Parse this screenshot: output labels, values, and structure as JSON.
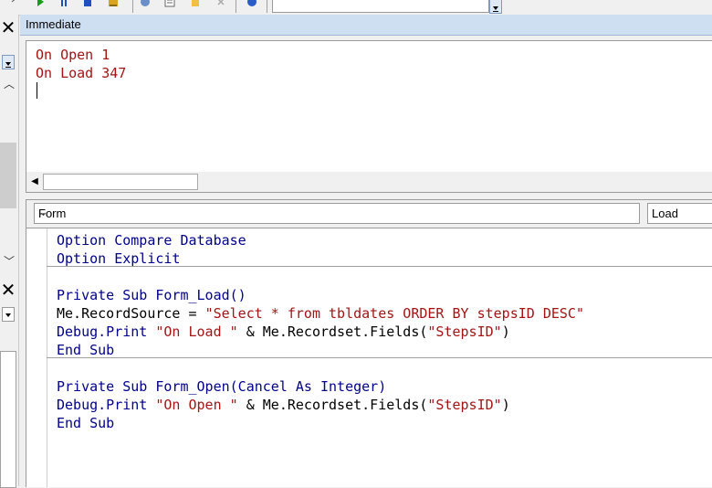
{
  "toolbar": {
    "icons": [
      "run-icon",
      "break-icon",
      "reset-icon",
      "design-mode-icon",
      "project-explorer-icon",
      "properties-icon",
      "object-browser-icon",
      "toolbox-icon",
      "help-icon"
    ]
  },
  "immediate": {
    "title": "Immediate",
    "lines": [
      "On Open 1",
      "On Load 347"
    ]
  },
  "code_window": {
    "object_selector": "Form",
    "procedure_selector": "Load",
    "declarations": [
      {
        "kw": "Option Compare Database"
      },
      {
        "kw": "Option Explicit"
      }
    ],
    "form_load": {
      "signature": "Private Sub Form_Load()",
      "line1_a": "Me.RecordSource = ",
      "line1_str": "\"Select * from tbldates ORDER BY stepsID DESC\"",
      "line2_a": "Debug.Print ",
      "line2_str": "\"On Load \"",
      "line2_b": " & Me.Recordset.Fields(",
      "line2_str2": "\"StepsID\"",
      "line2_c": ")",
      "end": "End Sub"
    },
    "form_open": {
      "signature": "Private Sub Form_Open(Cancel As Integer)",
      "line1_a": "Debug.Print ",
      "line1_str": "\"On Open \"",
      "line1_b": " & Me.Recordset.Fields(",
      "line1_str2": "\"StepsID\"",
      "line1_c": ")",
      "end": "End Sub"
    }
  },
  "colors": {
    "keyword": "#00008b",
    "string": "#a31515",
    "title_bar": "#cfdff2"
  }
}
